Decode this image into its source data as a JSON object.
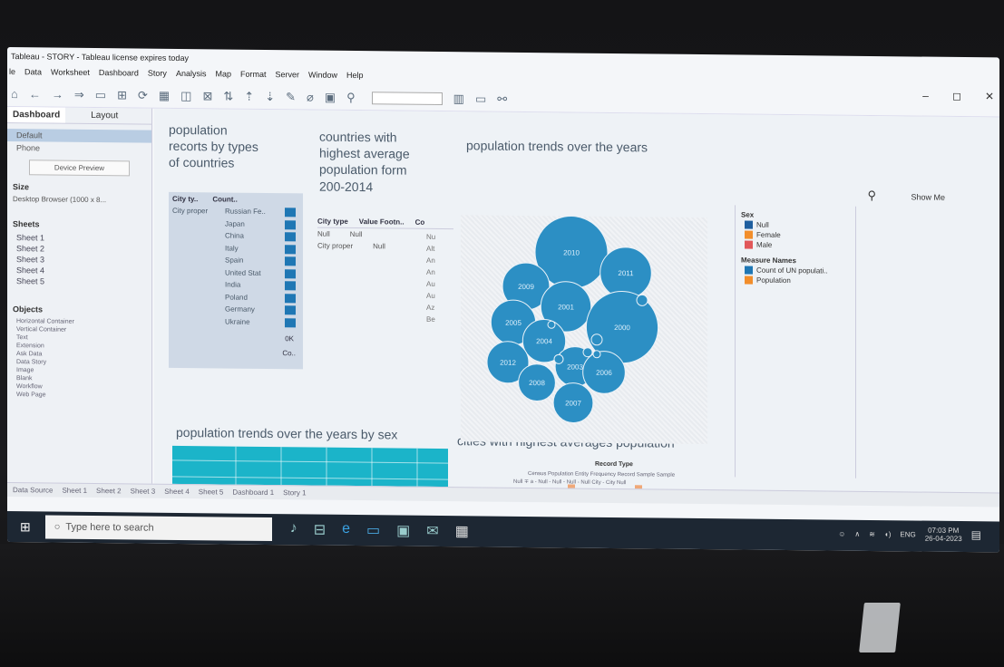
{
  "window": {
    "title": "Tableau - STORY - Tableau license expires today",
    "menu": [
      "le",
      "Data",
      "Worksheet",
      "Dashboard",
      "Story",
      "Analysis",
      "Map",
      "Format",
      "Server",
      "Window",
      "Help"
    ],
    "controls": [
      "–",
      "◻",
      "✕"
    ]
  },
  "leftpane": {
    "tabs": [
      "Dashboard",
      "Layout"
    ],
    "devices": [
      "Default",
      "Phone"
    ],
    "device_preview": "Device Preview",
    "size_label": "Size",
    "size_value": "Desktop Browser (1000 x 8...",
    "sheets_label": "Sheets",
    "sheets": [
      "Sheet 1",
      "Sheet 2",
      "Sheet 3",
      "Sheet 4",
      "Sheet 5"
    ],
    "objects_label": "Objects",
    "objects": [
      "Horizontal Container",
      "Vertical Container",
      "Text",
      "Extension",
      "Ask Data",
      "Data Story",
      "Image",
      "Blank",
      "Workflow",
      "Web Page"
    ]
  },
  "zones": {
    "title1": "population\nrecorts by types\nof countries",
    "title2": "countries with\nhighest average\npopulation form\n200-2014",
    "title3": "population trends over the years",
    "title4": "population trends over the years by sex",
    "title5": "cities with highest averages population"
  },
  "table1": {
    "headers": [
      "City ty..",
      "Count.."
    ],
    "city_type": "City proper",
    "countries": [
      "Russian Fe..",
      "Japan",
      "China",
      "Italy",
      "Spain",
      "United Stat",
      "India",
      "Poland",
      "Germany",
      "Ukraine"
    ],
    "footer": [
      "0K",
      "Co.."
    ]
  },
  "table2": {
    "headers": [
      "City type",
      "Value Footn..",
      "Co"
    ],
    "rows": [
      [
        "Null",
        "Null"
      ],
      [
        "City proper",
        "Null"
      ]
    ],
    "right_col": [
      "Nu",
      "Alt",
      "An",
      "An",
      "Au",
      "Au",
      "Az",
      "Be"
    ]
  },
  "bubbles": [
    {
      "label": "2010",
      "weight": 1.0
    },
    {
      "label": "2011",
      "weight": 0.5
    },
    {
      "label": "2009",
      "weight": 0.42
    },
    {
      "label": "2001",
      "weight": 0.48
    },
    {
      "label": "2005",
      "weight": 0.38
    },
    {
      "label": "2000",
      "weight": 0.98
    },
    {
      "label": "2004",
      "weight": 0.35
    },
    {
      "label": "2012",
      "weight": 0.33
    },
    {
      "label": "2003",
      "weight": 0.3
    },
    {
      "label": "2008",
      "weight": 0.26
    },
    {
      "label": "2006",
      "weight": 0.34
    },
    {
      "label": "2007",
      "weight": 0.3
    }
  ],
  "legend": {
    "sex_title": "Sex",
    "sex": [
      {
        "label": "Null",
        "color": "#1f5f9f"
      },
      {
        "label": "Female",
        "color": "#f28e2b"
      },
      {
        "label": "Male",
        "color": "#e15759"
      }
    ],
    "measure_title": "Measure Names",
    "measures": [
      {
        "label": "Count of UN populati..",
        "color": "#1f77b4"
      },
      {
        "label": "Population",
        "color": "#f28e2b"
      }
    ]
  },
  "showme": "Show Me",
  "barchart": {
    "title": "Record Type",
    "header_text": "Census Population Entity Frequency Record Sample Sample",
    "subheader_text": "Null  ∓  a   -  Null   -  Null   -  Null   -  Null  City   -  City  Null",
    "bar_color": "#f0a878"
  },
  "tabs": [
    "Data Source",
    "Sheet 1",
    "Sheet 2",
    "Sheet 3",
    "Sheet 4",
    "Sheet 5",
    "Dashboard 1",
    "Story 1"
  ],
  "taskbar": {
    "search_placeholder": "Type here to search",
    "lang": "ENG",
    "time": "07:03 PM",
    "date": "26-04-2023"
  },
  "colors": {
    "bubble": "#2c8fc4",
    "bubble_edge": "#1a78ae",
    "teal": "#1bb4c9"
  }
}
